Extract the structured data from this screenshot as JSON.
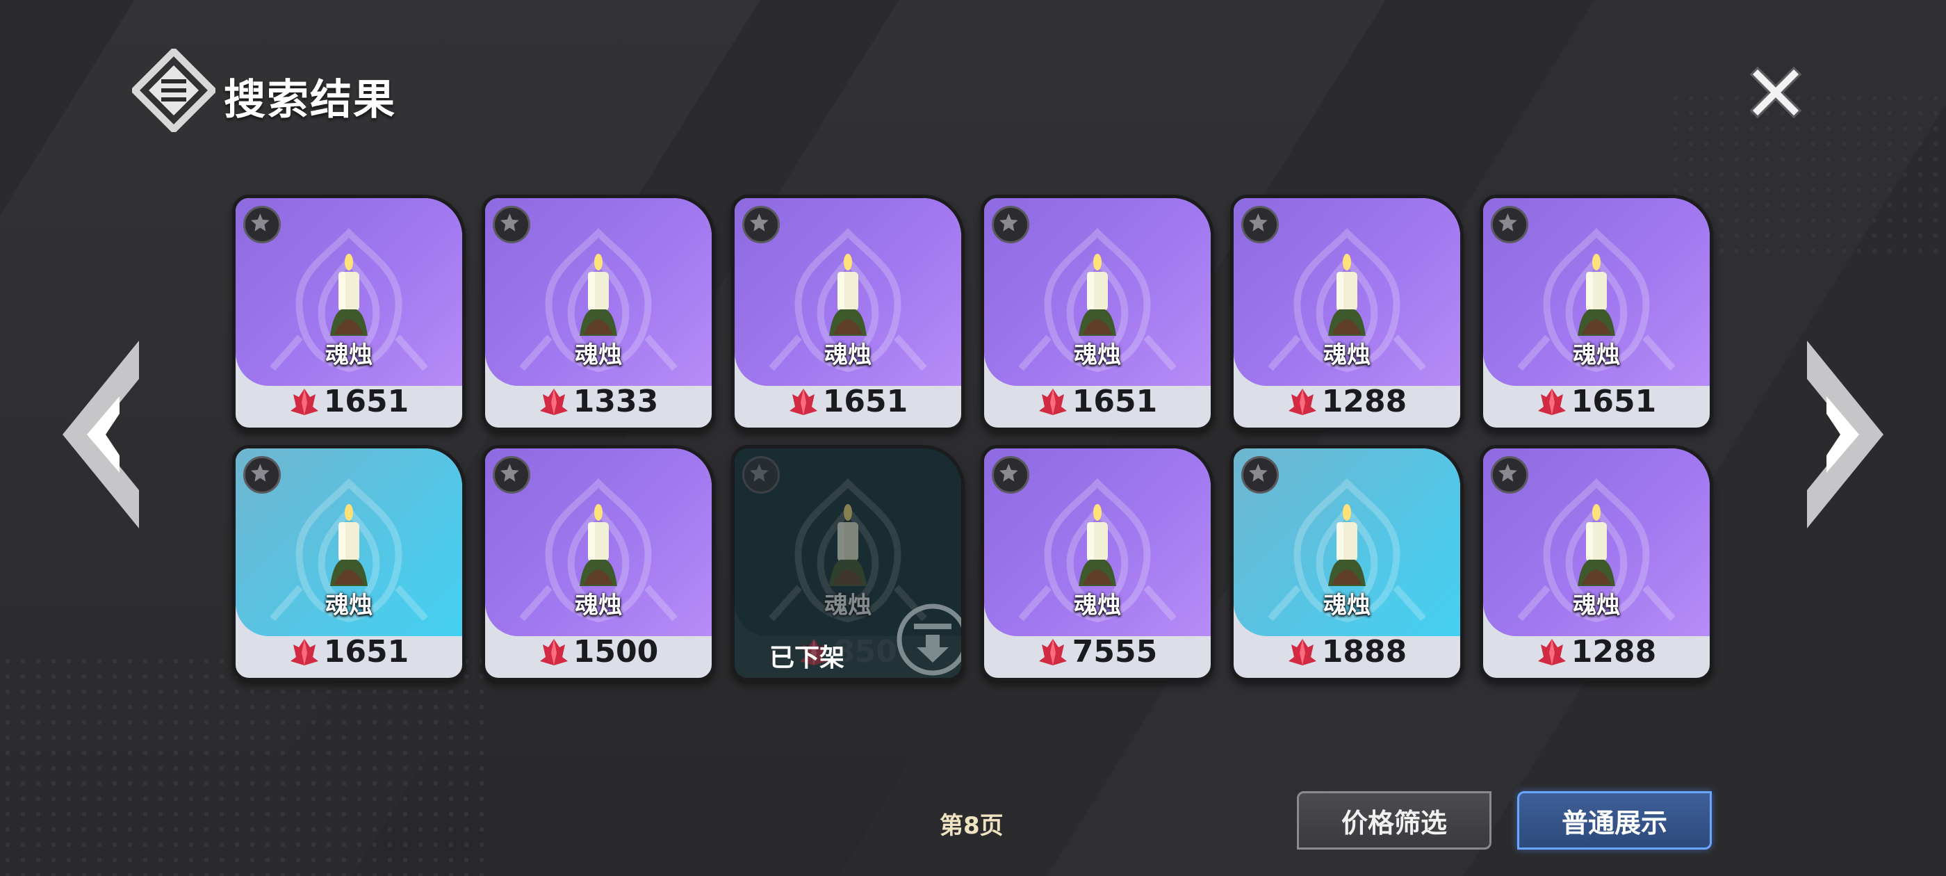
{
  "header": {
    "title": "搜索结果",
    "logo_icon": "search-results-logo-icon",
    "close_icon": "close-icon"
  },
  "navigation": {
    "prev_icon": "chevron-left-icon",
    "next_icon": "chevron-right-icon"
  },
  "colors": {
    "purple_card": "#a178ef",
    "blue_card": "#54c6e6",
    "sold_card": "#0f2c33",
    "accent_button": "#6aa6ff"
  },
  "items": [
    {
      "name": "魂烛",
      "price": "1651",
      "rarity": "purple"
    },
    {
      "name": "魂烛",
      "price": "1333",
      "rarity": "purple"
    },
    {
      "name": "魂烛",
      "price": "1651",
      "rarity": "purple"
    },
    {
      "name": "魂烛",
      "price": "1651",
      "rarity": "purple"
    },
    {
      "name": "魂烛",
      "price": "1288",
      "rarity": "purple"
    },
    {
      "name": "魂烛",
      "price": "1651",
      "rarity": "purple"
    },
    {
      "name": "魂烛",
      "price": "1651",
      "rarity": "blue"
    },
    {
      "name": "魂烛",
      "price": "1500",
      "rarity": "purple"
    },
    {
      "name": "魂烛",
      "price": "850",
      "rarity": "sold",
      "status": "已下架"
    },
    {
      "name": "魂烛",
      "price": "7555",
      "rarity": "purple"
    },
    {
      "name": "魂烛",
      "price": "1888",
      "rarity": "blue"
    },
    {
      "name": "魂烛",
      "price": "1288",
      "rarity": "purple"
    }
  ],
  "footer": {
    "page_label": "第8页",
    "filter_button": "价格筛选",
    "normal_button": "普通展示"
  }
}
